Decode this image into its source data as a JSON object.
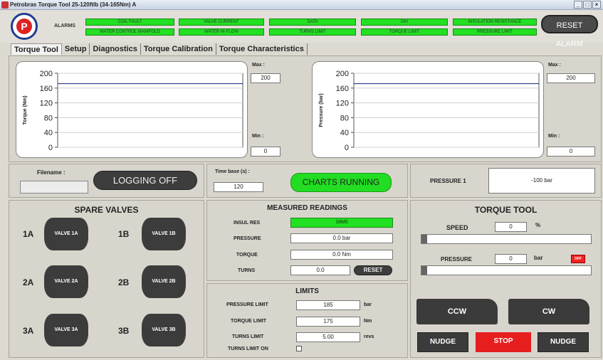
{
  "window": {
    "title": "Petrobras Torque Tool 25-120ftlb (34-165Nm) A",
    "controls": [
      "_",
      "□",
      "×"
    ]
  },
  "header": {
    "alarms_label": "ALARMS",
    "alarms_row1": [
      "COIL FAULT",
      "VALVE CURRENT",
      "DATA",
      "24V",
      "INSULATION RESISTANCE"
    ],
    "alarms_row2": [
      "WATER CONTROL MANIFOLD",
      "WATER HI-FLOW",
      "TURNS LIMIT",
      "TORQUE LIMIT",
      "PRESSURE LIMIT"
    ],
    "reset_alarm": "RESET ALARM",
    "logo_letter": "P",
    "alarm_color": "#22e022"
  },
  "tabs": [
    "Torque Tool",
    "Setup",
    "Diagnostics",
    "Torque Calibration",
    "Torque Characteristics"
  ],
  "charts": {
    "torque": {
      "ylabel": "Torque (Nm)",
      "ticks": [
        "200",
        "160",
        "120",
        "80",
        "40",
        "0"
      ],
      "max_label": "Max :",
      "max_value": "200",
      "min_label": "Min :",
      "min_value": "0"
    },
    "pressure": {
      "ylabel": "Pressure (bar)",
      "ticks": [
        "200",
        "160",
        "120",
        "80",
        "40",
        "0"
      ],
      "max_label": "Max :",
      "max_value": "200",
      "min_label": "Min :",
      "min_value": "0"
    }
  },
  "chart_data": [
    {
      "type": "line",
      "ylabel": "Torque (Nm)",
      "ylim": [
        0,
        200
      ],
      "series": [
        {
          "values": [
            172,
            172
          ]
        }
      ]
    },
    {
      "type": "line",
      "ylabel": "Pressure (bar)",
      "ylim": [
        0,
        200
      ],
      "series": [
        {
          "values": [
            172,
            172
          ]
        }
      ]
    }
  ],
  "logging": {
    "filename_label": "Filename :",
    "filename_value": "",
    "button": "LOGGING OFF"
  },
  "timebase": {
    "label": "Time base (s) :",
    "value": "120",
    "button": "CHARTS RUNNING"
  },
  "pressure1": {
    "label": "PRESSURE 1",
    "value": "-100 bar"
  },
  "spare": {
    "title": "SPARE VALVES",
    "valves": [
      {
        "label": "1A",
        "button": "VALVE 1A"
      },
      {
        "label": "1B",
        "button": "VALVE 1B"
      },
      {
        "label": "2A",
        "button": "VALVE 2A"
      },
      {
        "label": "2B",
        "button": "VALVE 2B"
      },
      {
        "label": "3A",
        "button": "VALVE 3A"
      },
      {
        "label": "3B",
        "button": "VALVE 3B"
      }
    ]
  },
  "measured": {
    "title": "MEASURED READINGS",
    "insul_label": "INSUL RES",
    "insul_value": "16M0",
    "pressure_label": "PRESSURE",
    "pressure_value": "0.0 bar",
    "torque_label": "TORQUE",
    "torque_value": "0.0  Nm",
    "turns_label": "TURNS",
    "turns_value": "0.0",
    "reset": "RESET"
  },
  "limits": {
    "title": "LIMITS",
    "pressure_label": "PRESSURE LIMIT",
    "pressure_value": "185",
    "pressure_unit": "bar",
    "torque_label": "TORQUE LIMIT",
    "torque_value": "175",
    "torque_unit": "Nm",
    "turns_label": "TURNS LIMIT",
    "turns_value": "5.00",
    "turns_unit": "revs",
    "turns_on_label": "TURNS LIMIT ON"
  },
  "torque_tool": {
    "title": "TORQUE TOOL",
    "speed_label": "SPEED",
    "speed_value": "0",
    "speed_unit": "%",
    "speed_level": 0,
    "pressure_label": "PRESSURE",
    "pressure_value": "0",
    "pressure_unit": "bar",
    "pressure_level": 0,
    "off": "OFF",
    "ccw": "CCW",
    "cw": "CW",
    "nudge_left": "NUDGE",
    "stop": "STOP",
    "nudge_right": "NUDGE"
  }
}
